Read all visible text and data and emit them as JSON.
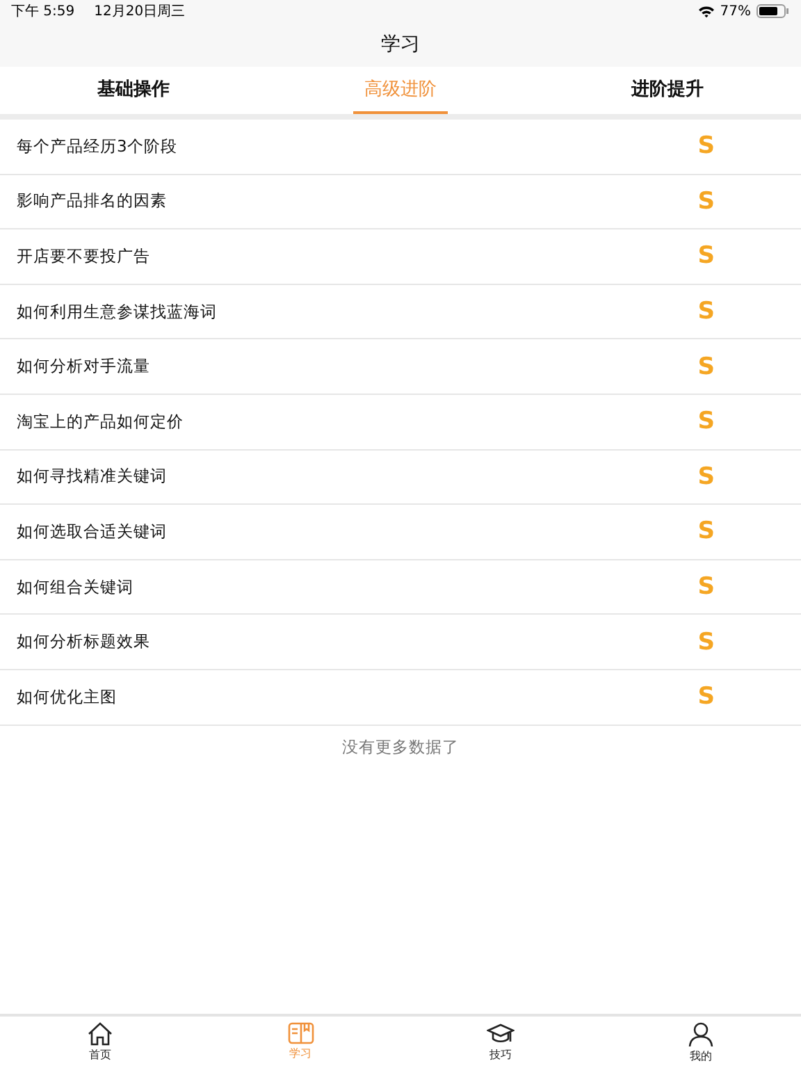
{
  "status_bar": {
    "time": "下午 5:59",
    "date": "12月20日周三",
    "battery_text": "77%"
  },
  "nav_bar": {
    "title": "学习"
  },
  "tabs": [
    {
      "label": "基础操作",
      "selected": false
    },
    {
      "label": "高级进阶",
      "selected": true
    },
    {
      "label": "进阶提升",
      "selected": false
    }
  ],
  "list": [
    {
      "title": "每个产品经历3个阶段",
      "badge": "S"
    },
    {
      "title": "影响产品排名的因素",
      "badge": "S"
    },
    {
      "title": "开店要不要投广告",
      "badge": "S"
    },
    {
      "title": "如何利用生意参谋找蓝海词",
      "badge": "S"
    },
    {
      "title": "如何分析对手流量",
      "badge": "S"
    },
    {
      "title": "淘宝上的产品如何定价",
      "badge": "S"
    },
    {
      "title": "如何寻找精准关键词",
      "badge": "S"
    },
    {
      "title": "如何选取合适关键词",
      "badge": "S"
    },
    {
      "title": "如何组合关键词",
      "badge": "S"
    },
    {
      "title": "如何分析标题效果",
      "badge": "S"
    },
    {
      "title": "如何优化主图",
      "badge": "S"
    }
  ],
  "list_footer": "没有更多数据了",
  "tab_bar": [
    {
      "kind": "home",
      "label": "首页",
      "selected": false
    },
    {
      "kind": "book",
      "label": "学习",
      "selected": true
    },
    {
      "kind": "cap",
      "label": "技巧",
      "selected": false
    },
    {
      "kind": "person",
      "label": "我的",
      "selected": false
    }
  ]
}
